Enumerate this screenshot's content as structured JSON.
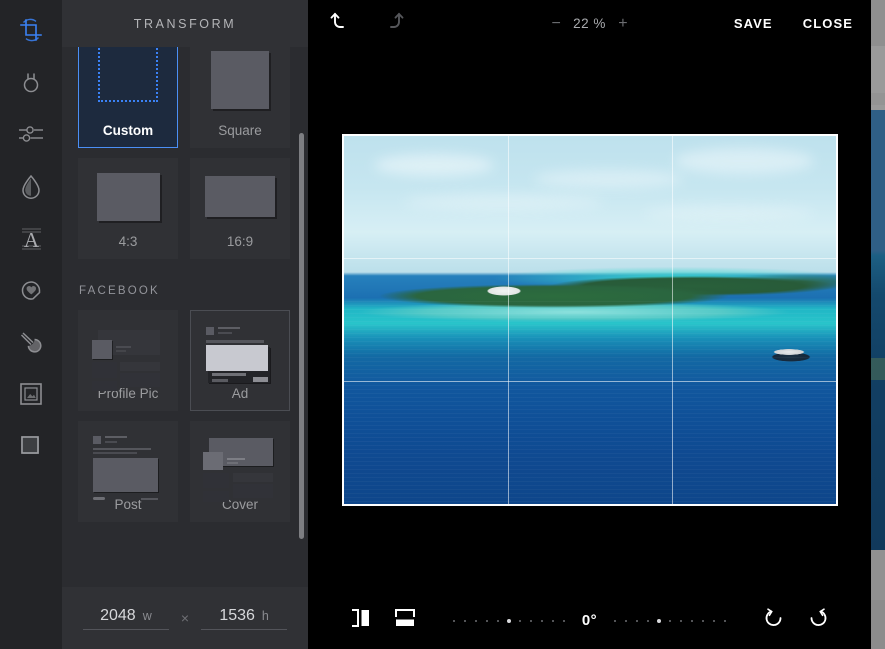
{
  "app": {
    "background": {
      "name": "host-page"
    },
    "accent_color": "#3b82f6",
    "panel_bg": "#2b2c30",
    "rail_bg": "#232427"
  },
  "rail": {
    "items": [
      {
        "icon": "crop-transform-icon",
        "name": "transform",
        "active": true
      },
      {
        "icon": "light-bulb-icon",
        "name": "light",
        "active": false
      },
      {
        "icon": "sliders-icon",
        "name": "adjust",
        "active": false
      },
      {
        "icon": "droplet-icon",
        "name": "color",
        "active": false
      },
      {
        "icon": "text-a-icon",
        "name": "text",
        "active": false
      },
      {
        "icon": "sticker-heart-icon",
        "name": "sticker",
        "active": false
      },
      {
        "icon": "brush-icon",
        "name": "brush",
        "active": false
      },
      {
        "icon": "frame-icon",
        "name": "frame",
        "active": false
      },
      {
        "icon": "vignette-square-icon",
        "name": "vignette",
        "active": false
      }
    ]
  },
  "panel": {
    "title": "TRANSFORM",
    "presets": [
      {
        "label": "Custom",
        "art": "dotted-crop",
        "selected": true,
        "hovered": false
      },
      {
        "label": "Square",
        "art": "square",
        "selected": false,
        "hovered": false
      },
      {
        "label": "4:3",
        "art": "ratio43",
        "selected": false,
        "hovered": false
      },
      {
        "label": "16:9",
        "art": "ratio169",
        "selected": false,
        "hovered": false
      }
    ],
    "section": {
      "title": "FACEBOOK",
      "presets": [
        {
          "label": "Profile Pic",
          "art": "fb-profile",
          "selected": false,
          "hovered": false
        },
        {
          "label": "Ad",
          "art": "fb-ad",
          "selected": false,
          "hovered": true
        },
        {
          "label": "Post",
          "art": "fb-post",
          "selected": false,
          "hovered": false
        },
        {
          "label": "Cover",
          "art": "fb-cover",
          "selected": false,
          "hovered": false
        }
      ]
    },
    "scrollbar": {
      "name": "panel-scrollbar"
    }
  },
  "dimensions": {
    "width_value": "2048",
    "width_unit": "w",
    "separator": "×",
    "height_value": "1536",
    "height_unit": "h"
  },
  "topbar": {
    "undo_icon": "undo-icon",
    "redo_icon": "redo-icon",
    "zoom_out": "−",
    "zoom_level": "22 %",
    "zoom_in": "+",
    "save_label": "SAVE",
    "close_label": "CLOSE"
  },
  "canvas": {
    "crop_grid": "rule-of-thirds",
    "photo_alt": "tropical-island-seascape"
  },
  "bottombar": {
    "flip_horizontal_icon": "flip-horizontal-icon",
    "flip_vertical_icon": "flip-vertical-icon",
    "rotation_value": "0°",
    "dial_left_dots": 11,
    "dial_right_dots": 11,
    "rotate_ccw_icon": "rotate-counterclockwise-icon",
    "rotate_cw_icon": "rotate-clockwise-icon"
  }
}
